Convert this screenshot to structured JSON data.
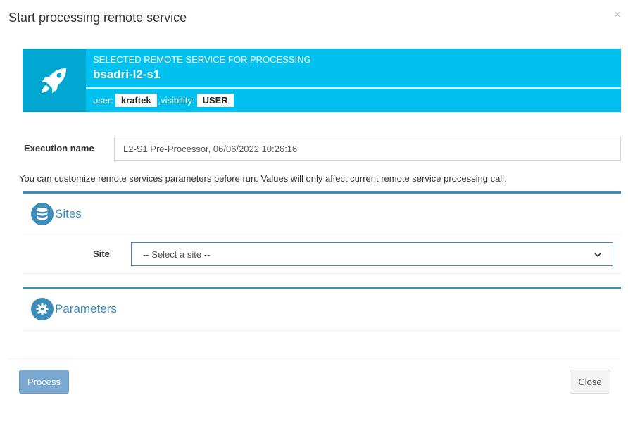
{
  "dialog": {
    "title": "Start processing remote service",
    "close_symbol": "×"
  },
  "service": {
    "caption": "SELECTED REMOTE SERVICE FOR PROCESSING",
    "name": "bsadri-l2-s1",
    "user_label": "user:",
    "user": "kraftek",
    "visibility_label": ",visibility:",
    "visibility": "USER",
    "icon": "rocket-icon",
    "colors": {
      "box": "#00c0ef",
      "icon_bg": "#00a7d0"
    }
  },
  "execution": {
    "label": "Execution name",
    "value": "L2-S1 Pre-Processor, 06/06/2022 10:26:16"
  },
  "help_text": "You can customize remote services parameters before run. Values will only affect current remote service processing call.",
  "sites_panel": {
    "title": "Sites",
    "icon": "database-icon",
    "site_label": "Site",
    "site_selected": "-- Select a site --"
  },
  "parameters_panel": {
    "title": "Parameters",
    "icon": "gear-icon"
  },
  "footer": {
    "process_label": "Process",
    "close_label": "Close"
  },
  "accent_color": "#3c8dbc"
}
